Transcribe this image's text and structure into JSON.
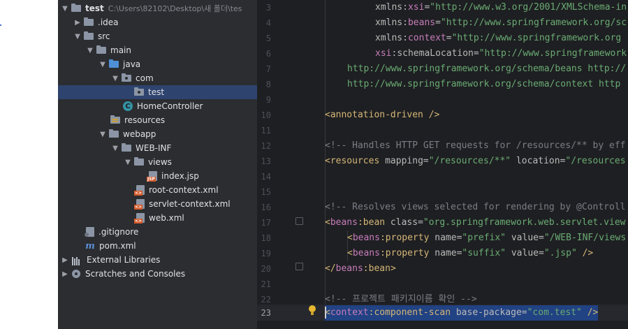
{
  "project_tree": {
    "root": {
      "name": "test",
      "path": "C:\\Users\\82102\\Desktop\\새 폴더\\tes"
    },
    "items": [
      {
        "label": ".idea"
      },
      {
        "label": "src"
      },
      {
        "label": "main"
      },
      {
        "label": "java"
      },
      {
        "label": "com"
      },
      {
        "label": "test"
      },
      {
        "label": "HomeController"
      },
      {
        "label": "resources"
      },
      {
        "label": "webapp"
      },
      {
        "label": "WEB-INF"
      },
      {
        "label": "views"
      },
      {
        "label": "index.jsp"
      },
      {
        "label": "root-context.xml"
      },
      {
        "label": "servlet-context.xml"
      },
      {
        "label": "web.xml"
      },
      {
        "label": ".gitignore"
      },
      {
        "label": "pom.xml"
      },
      {
        "label": "External Libraries"
      },
      {
        "label": "Scratches and Consoles"
      }
    ],
    "class_letter": "C"
  },
  "editor": {
    "line_numbers": [
      "3",
      "4",
      "5",
      "6",
      "7",
      "8",
      "9",
      "10",
      "11",
      "12",
      "13",
      "14",
      "15",
      "16",
      "17",
      "18",
      "19",
      "20",
      "21",
      "22",
      "23"
    ],
    "lines": {
      "l3": {
        "p": "xmlns",
        "c": ":",
        "a": "xsi",
        "e": "=",
        "v": "\"http://www.w3.org/2001/XMLSchema-in"
      },
      "l4": {
        "p": "xmlns",
        "c": ":",
        "a": "beans",
        "e": "=",
        "v": "\"http://www.springframework.org/sc"
      },
      "l5": {
        "p": "xmlns",
        "c": ":",
        "a": "context",
        "e": "=",
        "v": "\"http://www.springframework.org"
      },
      "l6": {
        "p": "xsi",
        "c": ":",
        "a": "schemaLocation",
        "e": "=",
        "v": "\"http://www.springframework"
      },
      "l7": {
        "v": "http://www.springframework.org/schema/beans http://"
      },
      "l8": {
        "v": "http://www.springframework.org/schema/context http"
      },
      "l10": {
        "o": "<",
        "t": "annotation-driven",
        "x": " />"
      },
      "l12": {
        "c": "<!-- Handles HTTP GET requests for /resources/** by eff"
      },
      "l13": {
        "o": "<",
        "t": "resources",
        "a1": " mapping",
        "e1": "=",
        "v1": "\"/resources/**\"",
        "a2": " location",
        "e2": "=",
        "v2": "\"/resources"
      },
      "l16": {
        "c": "<!-- Resolves views selected for rendering by @Controll"
      },
      "l17": {
        "o": "<",
        "p": "beans",
        "k": ":",
        "t": "bean",
        "a1": " class",
        "e1": "=",
        "v1": "\"org.springframework.web.servlet.view"
      },
      "l18": {
        "o": "<",
        "p": "beans",
        "k": ":",
        "t": "property",
        "a1": " name",
        "e1": "=",
        "v1": "\"prefix\"",
        "a2": " value",
        "e2": "=",
        "v2": "\"/WEB-INF/views"
      },
      "l19": {
        "o": "<",
        "p": "beans",
        "k": ":",
        "t": "property",
        "a1": " name",
        "e1": "=",
        "v1": "\"suffix\"",
        "a2": " value",
        "e2": "=",
        "v2": "\".jsp\"",
        "x": " />"
      },
      "l20": {
        "o": "</",
        "p": "beans",
        "k": ":",
        "t": "bean",
        "x": ">"
      },
      "l22": {
        "c": "<!-- 프로젝트 패키지이름 확인 -->"
      },
      "l23": {
        "o": "<",
        "p": "context",
        "k": ":",
        "t": "component-scan",
        "a1": " base-package",
        "e1": "=",
        "v1": "\"com.test\"",
        "x": " />"
      }
    }
  },
  "colors": {
    "panel_bg": "#2b2d30",
    "editor_bg": "#1e1f22",
    "selection": "#2e436e",
    "tag": "#d5b778",
    "string": "#6aab73",
    "namespace": "#c77dbb",
    "comment": "#7a7e85"
  }
}
